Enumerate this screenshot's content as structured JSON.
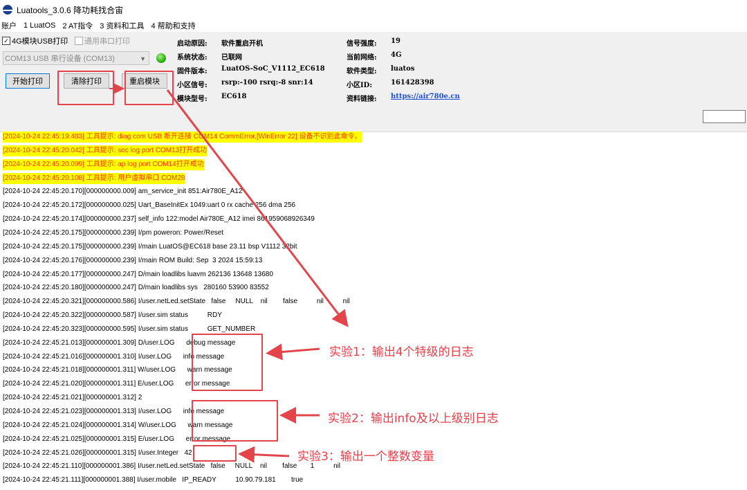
{
  "window": {
    "title": "Luatools_3.0.6 降功耗找合宙"
  },
  "menu": [
    "账户",
    "1 LuatOS",
    "2 AT指令",
    "3 资料和工具",
    "4 帮助和支持"
  ],
  "options": {
    "usb_print": "4G模块USB打印",
    "serial_print": "通用串口打印",
    "port_select": "COM13 USB 串行设备 (COM13)"
  },
  "buttons": {
    "start_print": "开始打印",
    "clear_print": "清除打印",
    "restart_module": "重启模块"
  },
  "device_info": {
    "left": [
      {
        "k": "启动原因:",
        "v": "软件重启开机"
      },
      {
        "k": "系统状态:",
        "v": "已联网"
      },
      {
        "k": "固件版本:",
        "v": "LuatOS-SoC_V1112_EC618"
      },
      {
        "k": "小区信号:",
        "v": "rsrp:-100 rsrq:-8 snr:14"
      },
      {
        "k": "模块型号:",
        "v": "EC618"
      }
    ],
    "right": [
      {
        "k": "信号强度:",
        "v": "19"
      },
      {
        "k": "当前网络:",
        "v": "4G"
      },
      {
        "k": "软件类型:",
        "v": "luatos"
      },
      {
        "k": "小区ID:",
        "v": "161428398"
      },
      {
        "k": "资料链接:",
        "v": "https://air780e.cn"
      }
    ]
  },
  "log_lines": [
    {
      "ts": "[2024-10-24 22:45:19.483]",
      "msg": " 工具提示: diag com USB 断开连接 COM14 CommError,[WinError 22] 设备不识别此命令。",
      "hl": true
    },
    {
      "ts": "[2024-10-24 22:45:20.042]",
      "msg": " 工具提示: soc log port COM13打开成功",
      "hl": true
    },
    {
      "ts": "[2024-10-24 22:45:20.099]",
      "msg": " 工具提示: ap log port COM14打开成功",
      "hl": true
    },
    {
      "ts": "[2024-10-24 22:45:20.108]",
      "msg": " 工具提示: 用户虚拟串口 COM28",
      "hl": true
    },
    {
      "ts": "[2024-10-24 22:45:20.170]",
      "msg": "[000000000.009] am_service_init 851:Air780E_A12"
    },
    {
      "ts": "[2024-10-24 22:45:20.172]",
      "msg": "[000000000.025] Uart_BaseInitEx 1049:uart 0 rx cache 256 dma 256"
    },
    {
      "ts": "[2024-10-24 22:45:20.174]",
      "msg": "[000000000.237] self_info 122:model Air780E_A12 imei 861959068926349"
    },
    {
      "ts": "[2024-10-24 22:45:20.175]",
      "msg": "[000000000.239] I/pm poweron: Power/Reset"
    },
    {
      "ts": "[2024-10-24 22:45:20.175]",
      "msg": "[000000000.239] I/main LuatOS@EC618 base 23.11 bsp V1112 32bit"
    },
    {
      "ts": "[2024-10-24 22:45:20.176]",
      "msg": "[000000000.239] I/main ROM Build: Sep  3 2024 15:59:13"
    },
    {
      "ts": "[2024-10-24 22:45:20.177]",
      "msg": "[000000000.247] D/main loadlibs luavm 262136 13648 13680"
    },
    {
      "ts": "[2024-10-24 22:45:20.180]",
      "msg": "[000000000.247] D/main loadlibs sys   280160 53900 83552"
    },
    {
      "ts": "[2024-10-24 22:45:20.321]",
      "msg": "[000000000.586] I/user.netLed.setState   false     NULL    nil        false          nil          nil"
    },
    {
      "ts": "[2024-10-24 22:45:20.322]",
      "msg": "[000000000.587] I/user.sim status          RDY"
    },
    {
      "ts": "[2024-10-24 22:45:20.323]",
      "msg": "[000000000.595] I/user.sim status          GET_NUMBER"
    },
    {
      "ts": "[2024-10-24 22:45:21.013]",
      "msg": "[000000001.309] D/user.LOG      debug message"
    },
    {
      "ts": "[2024-10-24 22:45:21.016]",
      "msg": "[000000001.310] I/user.LOG      info message"
    },
    {
      "ts": "[2024-10-24 22:45:21.018]",
      "msg": "[000000001.311] W/user.LOG      warn message"
    },
    {
      "ts": "[2024-10-24 22:45:21.020]",
      "msg": "[000000001.311] E/user.LOG      error message"
    },
    {
      "ts": "[2024-10-24 22:45:21.021]",
      "msg": "[000000001.312] 2"
    },
    {
      "ts": "[2024-10-24 22:45:21.023]",
      "msg": "[000000001.313] I/user.LOG      info message"
    },
    {
      "ts": "[2024-10-24 22:45:21.024]",
      "msg": "[000000001.314] W/user.LOG      warn message"
    },
    {
      "ts": "[2024-10-24 22:45:21.025]",
      "msg": "[000000001.315] E/user.LOG      error message"
    },
    {
      "ts": "[2024-10-24 22:45:21.026]",
      "msg": "[000000001.315] I/user.Integer   42"
    },
    {
      "ts": "[2024-10-24 22:45:21.110]",
      "msg": "[000000001.386] I/user.netLed.setState   false     NULL    nil        false       1          nil"
    },
    {
      "ts": "[2024-10-24 22:45:21.111]",
      "msg": "[000000001.388] I/user.mobile   IP_READY          10.90.79.181        true"
    }
  ],
  "annotations": {
    "exp1": "实验1：输出4个特级的日志",
    "exp2": "实验2：输出info及以上级别日志",
    "exp3": "实验3：输出一个整数变量"
  },
  "colors": {
    "annotation_red": "#e3454b",
    "highlight_yellow": "#ffff00",
    "highlight_text": "#ff3300",
    "link_blue": "#1a4fd6"
  },
  "icons": {
    "app": "luatools-logo-icon",
    "status_led": "green-status-led",
    "dropdown": "chevron-down-icon"
  }
}
